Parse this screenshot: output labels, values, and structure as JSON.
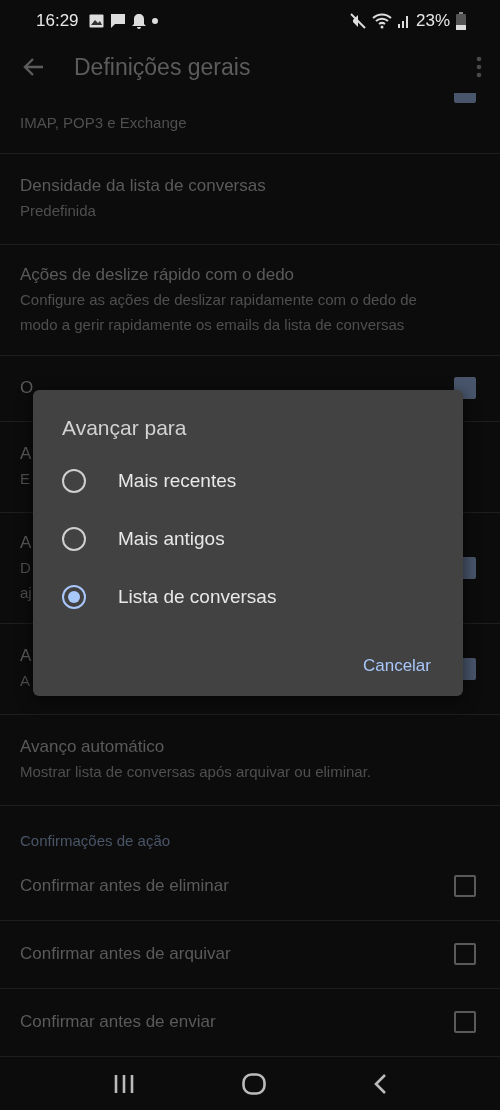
{
  "status_bar": {
    "time": "16:29",
    "battery": "23%"
  },
  "app_bar": {
    "title": "Definições gerais"
  },
  "settings": [
    {
      "subtitle_lines": [
        "IMAP, POP3 e Exchange"
      ],
      "checked": true,
      "kind": "clipped"
    },
    {
      "title": "Densidade da lista de conversas",
      "subtitle_lines": [
        "Predefinida"
      ]
    },
    {
      "title": "Ações de deslize rápido com o dedo",
      "subtitle_lines": [
        "Configure as ações de deslizar rapidamente com o dedo de",
        "modo a gerir rapidamente os emails da lista de conversas"
      ]
    },
    {
      "title": "O",
      "checked": true
    },
    {
      "title": "A",
      "subtitle_lines": [
        "E"
      ]
    },
    {
      "title": "A",
      "subtitle_lines": [
        "D",
        "aj"
      ],
      "checked": true
    },
    {
      "title": "A",
      "subtitle_lines": [
        "A"
      ],
      "checked": true
    },
    {
      "title": "Avanço automático",
      "subtitle_lines": [
        "Mostrar lista de conversas após arquivar ou eliminar."
      ]
    }
  ],
  "section": {
    "header": "Confirmações de ação",
    "items": [
      {
        "title": "Confirmar antes de eliminar",
        "checked": false
      },
      {
        "title": "Confirmar antes de arquivar",
        "checked": false
      },
      {
        "title": "Confirmar antes de enviar",
        "checked": false
      }
    ]
  },
  "dialog": {
    "title": "Avançar para",
    "options": [
      {
        "label": "Mais recentes",
        "selected": false
      },
      {
        "label": "Mais antigos",
        "selected": false
      },
      {
        "label": "Lista de conversas",
        "selected": true
      }
    ],
    "button": "Cancelar"
  }
}
